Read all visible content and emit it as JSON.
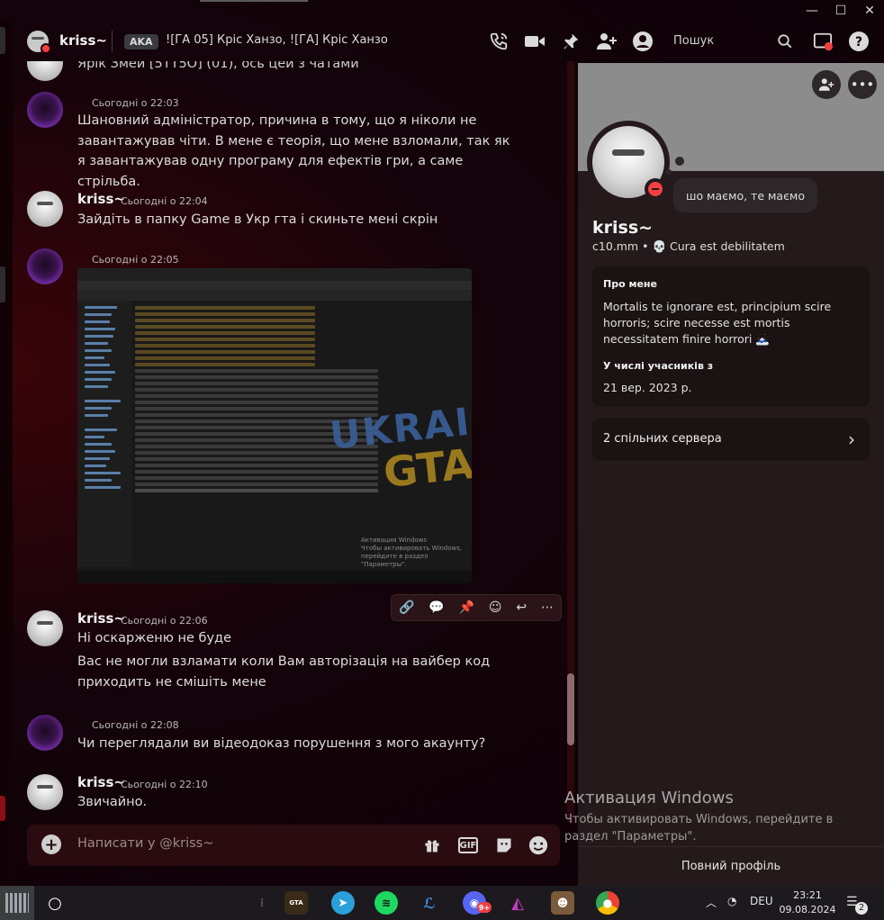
{
  "window": {
    "min": "—",
    "max": "☐",
    "close": "✕"
  },
  "header": {
    "username": "kriss~",
    "aka_badge": "AKA",
    "aka_names": "![ГА 05] Кріс Ханзо, ![ГА] Кріс Ханзо",
    "search_label": "Пошук"
  },
  "messages": {
    "cutoff": "Ярік Змей [5ТТ5О] (01), ось цей з чатами",
    "m1": {
      "time": "Сьогодні о 22:03",
      "text": "Шановний адміністратор, причина в тому, що я ніколи не завантажував чіти. В мене є теорія, що мене взломали, так як я завантажував одну програму для ефектів гри, а саме стрільба."
    },
    "m2": {
      "user": "kriss~",
      "time": "Сьогодні о 22:04",
      "text": "Зайдіть в папку Game в Укр гта і скиньте мені скрін"
    },
    "m3": {
      "time": "Сьогодні о 22:05",
      "watermark_line1": "Активация Windows",
      "watermark_line2": "Чтобы активировать Windows, перейдите в раздел \"Параметры\".",
      "logo_line1": "UKRAINE",
      "logo_line2": "GTA"
    },
    "m4": {
      "user": "kriss~",
      "time": "Сьогодні о 22:06",
      "text1": "Ні оскарженю не буде",
      "text2": "Вас не могли взламати коли Вам авторізація на вайбер код приходить не смішіть мене"
    },
    "m5": {
      "time": "Сьогодні о 22:08",
      "text": "Чи переглядали ви відеодоказ порушення з мого акаунту?"
    },
    "m6": {
      "user": "kriss~",
      "time": "Сьогодні о 22:10",
      "text": "Звичайно."
    }
  },
  "composer": {
    "placeholder": "Написати у @kriss~",
    "gif": "GIF"
  },
  "profile": {
    "status_bubble": "шо маємо, те маємо",
    "display_name": "kriss~",
    "username": "c10.mm",
    "custom_status": "💀 Cura est debilitatem",
    "about_header": "Про мене",
    "about_text": "Mortalis te ignorare est, principium scire horroris; scire necesse est mortis necessitatem finire horrori 🗻",
    "member_since_header": "У числі учасників з",
    "member_since": "21 вер. 2023 р.",
    "mutual_servers": "2 спільних сервера",
    "full_profile": "Повний профіль"
  },
  "activation": {
    "title": "Активация Windows",
    "subtitle": "Чтобы активировать Windows, перейдите в раздел \"Параметры\"."
  },
  "taskbar": {
    "lang": "DEU",
    "time": "23:21",
    "date": "09.08.2024",
    "notifications": "2",
    "discord_badge": "9+"
  },
  "colors": {
    "accent_red": "#f23f42",
    "panel": "#251a1b",
    "background": "#1a0306"
  }
}
